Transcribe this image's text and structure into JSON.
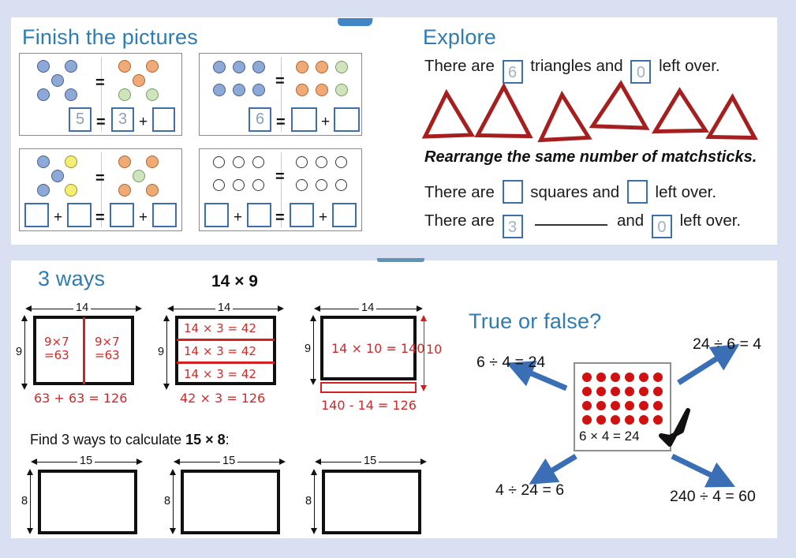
{
  "page": {
    "background": "#d9e0f1",
    "panel_background": "#ffffff",
    "heading_color": "#2f7cb0"
  },
  "finish_the_pictures": {
    "title": "Finish the pictures",
    "boxes": [
      {
        "id": "box1",
        "left_dots": [
          "blue",
          "blue",
          "blue",
          "blue",
          "blue"
        ],
        "left_layout": "quincunx-5",
        "right_dots": [
          "orange",
          "orange",
          "orange",
          "green",
          "green"
        ],
        "right_layout": "quincunx-5",
        "equation": [
          {
            "type": "box",
            "value": "5"
          },
          {
            "type": "sym",
            "value": "="
          },
          {
            "type": "box",
            "value": "3"
          },
          {
            "type": "sym",
            "value": "+"
          },
          {
            "type": "box",
            "value": ""
          }
        ]
      },
      {
        "id": "box2",
        "left_dots": [
          "blue",
          "blue",
          "blue",
          "blue",
          "blue",
          "blue"
        ],
        "left_layout": "grid-3x2",
        "right_dots": [
          "orange",
          "orange",
          "green",
          "orange",
          "orange",
          "green"
        ],
        "right_layout": "grid-3x2",
        "equation": [
          {
            "type": "box",
            "value": "6"
          },
          {
            "type": "sym",
            "value": "="
          },
          {
            "type": "box",
            "value": ""
          },
          {
            "type": "sym",
            "value": "+"
          },
          {
            "type": "box",
            "value": ""
          }
        ]
      },
      {
        "id": "box3",
        "left_dots": [
          "blue",
          "yellow",
          "blue",
          "blue",
          "yellow"
        ],
        "left_layout": "quincunx-5",
        "right_dots": [
          "orange",
          "orange",
          "green",
          "orange",
          "orange"
        ],
        "right_layout": "quincunx-5",
        "equation": [
          {
            "type": "box",
            "value": ""
          },
          {
            "type": "sym",
            "value": "+"
          },
          {
            "type": "box",
            "value": ""
          },
          {
            "type": "sym",
            "value": "="
          },
          {
            "type": "box",
            "value": ""
          },
          {
            "type": "sym",
            "value": "+"
          },
          {
            "type": "box",
            "value": ""
          }
        ]
      },
      {
        "id": "box4",
        "left_dots": [
          "empty",
          "empty",
          "empty",
          "empty",
          "empty",
          "empty"
        ],
        "left_layout": "grid-3x2",
        "right_dots": [
          "empty",
          "empty",
          "empty",
          "empty",
          "empty",
          "empty"
        ],
        "right_layout": "grid-3x2",
        "equation": [
          {
            "type": "box",
            "value": ""
          },
          {
            "type": "sym",
            "value": "+"
          },
          {
            "type": "box",
            "value": ""
          },
          {
            "type": "sym",
            "value": "="
          },
          {
            "type": "box",
            "value": ""
          },
          {
            "type": "sym",
            "value": "+"
          },
          {
            "type": "box",
            "value": ""
          }
        ]
      }
    ]
  },
  "explore": {
    "title": "Explore",
    "line1": {
      "prefix": "There are",
      "answer1": "6",
      "middle": "triangles and",
      "answer2": "0",
      "suffix": "left over."
    },
    "instruction": "Rearrange the same number of matchsticks.",
    "line2": {
      "prefix": "There are",
      "answer1": "",
      "middle": "squares and",
      "answer2": "",
      "suffix": "left over."
    },
    "line3": {
      "prefix": "There are",
      "answer1": "3",
      "middle": "and",
      "answer2": "0",
      "suffix": "left over."
    },
    "triangle_count": 6,
    "triangle_color": "#a51f1f"
  },
  "three_ways": {
    "title": "3 ways",
    "expression": "14 × 9",
    "diagrams": [
      {
        "id": "way1",
        "width_label": "14",
        "height_label": "9",
        "split": "vertical",
        "cells": [
          "9×7\n=63",
          "9×7\n=63"
        ],
        "result": "63 + 63 = 126"
      },
      {
        "id": "way2",
        "width_label": "14",
        "height_label": "9",
        "split": "horizontal-3",
        "cells": [
          "14 × 3 = 42",
          "14 × 3 = 42",
          "14 × 3 = 42"
        ],
        "result": "42 × 3 = 126"
      },
      {
        "id": "way3",
        "width_label": "14",
        "height_label": "9",
        "right_label": "10",
        "cells": [
          "14 × 10 = 140"
        ],
        "result": "140 - 14 = 126"
      }
    ],
    "task": {
      "prefix": "Find 3 ways to calculate ",
      "expression": "15 × 8",
      "suffix": ":"
    },
    "blank_rects": [
      {
        "width_label": "15",
        "height_label": "8"
      },
      {
        "width_label": "15",
        "height_label": "8"
      },
      {
        "width_label": "15",
        "height_label": "8"
      }
    ]
  },
  "true_or_false": {
    "title": "True or false?",
    "array": {
      "columns": 6,
      "rows": 4,
      "dot_color": "#cf1111"
    },
    "center_equation": "6 × 4 = 24",
    "has_tick": true,
    "options": [
      {
        "position": "top-left",
        "text": "6 ÷ 4 = 24"
      },
      {
        "position": "top-right",
        "text": "24 ÷ 6 = 4"
      },
      {
        "position": "bottom-left",
        "text": "4 ÷ 24 = 6"
      },
      {
        "position": "bottom-right",
        "text": "240 ÷ 4 = 60"
      }
    ],
    "arrow_color": "#3a6fb5"
  }
}
